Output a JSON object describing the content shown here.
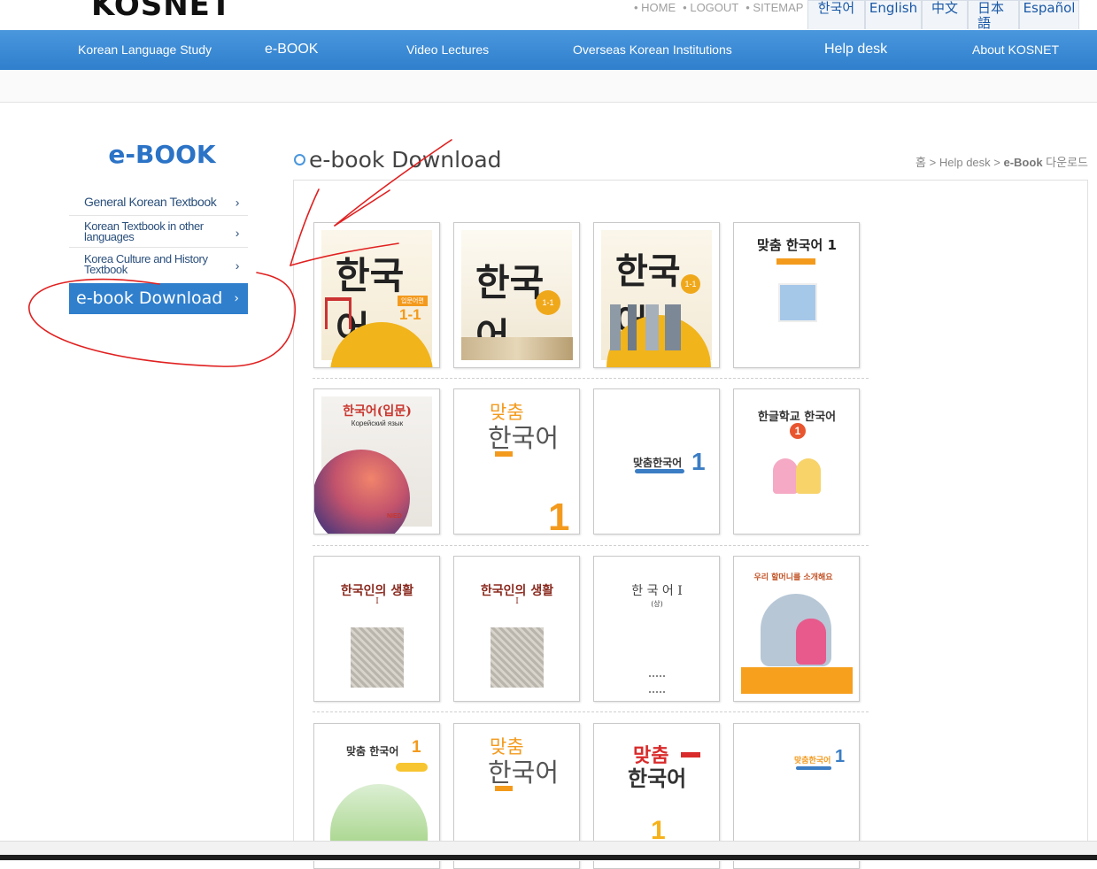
{
  "header": {
    "logo": "KOSNET",
    "top_links": [
      "• HOME",
      "• LOGOUT",
      "• SITEMAP"
    ],
    "languages": [
      "한국어",
      "English",
      "中文",
      "日本語",
      "Español"
    ]
  },
  "nav": {
    "items": [
      "Korean Language Study",
      "e-BOOK",
      "Video Lectures",
      "Overseas Korean Institutions",
      "Help desk",
      "About KOSNET"
    ]
  },
  "sidebar": {
    "title": "e-BOOK",
    "items": [
      {
        "label": "General Korean Textbook"
      },
      {
        "label": "Korean Textbook in other languages"
      },
      {
        "label": "Korea Culture and History Textbook"
      },
      {
        "label": "e-book Download"
      }
    ],
    "arrow": "›"
  },
  "content": {
    "title": "e-book Download",
    "breadcrumb": {
      "home": "홈",
      "sep1": " > ",
      "section": "Help desk",
      "sep2": " > ",
      "bold": "e-Book",
      "rest": " 다운로드"
    }
  },
  "books": {
    "b1": {
      "title": "한국어",
      "sub": "입문어편",
      "level": "1-1"
    },
    "b2": {
      "title": "한국어",
      "level": "1-1"
    },
    "b3": {
      "title": "한국어",
      "level": "1-1"
    },
    "b4": {
      "title": "맞춤 한국어 1"
    },
    "b5": {
      "title": "한국어(입문)",
      "sub": "Корейский язык",
      "label": "NIED"
    },
    "b6": {
      "top": "맞춤",
      "title": "한국어",
      "num": "1"
    },
    "b7": {
      "title": "맞춤한국어",
      "num": "1"
    },
    "b8": {
      "title": "한글학교 한국어",
      "num": "1"
    },
    "b9": {
      "title": "한국인의 생활",
      "num": "I"
    },
    "b10": {
      "title": "한국인의 생활",
      "num": "I"
    },
    "b11": {
      "title": "한 국 어 I",
      "sub": "(상)"
    },
    "b12": {
      "title": "우리 할머니를 소개해요"
    },
    "b13": {
      "title": "맞춤 한국어",
      "num": "1"
    },
    "b14": {
      "top": "맞춤",
      "title": "한국어"
    },
    "b15": {
      "top": "맞춤",
      "title": "한국어",
      "num": "1"
    },
    "b16": {
      "title": "맞춤한국어",
      "num": "1"
    }
  },
  "colors": {
    "accent": "#2f7fcd",
    "annotation": "#e02020",
    "orange": "#f39a1d"
  }
}
